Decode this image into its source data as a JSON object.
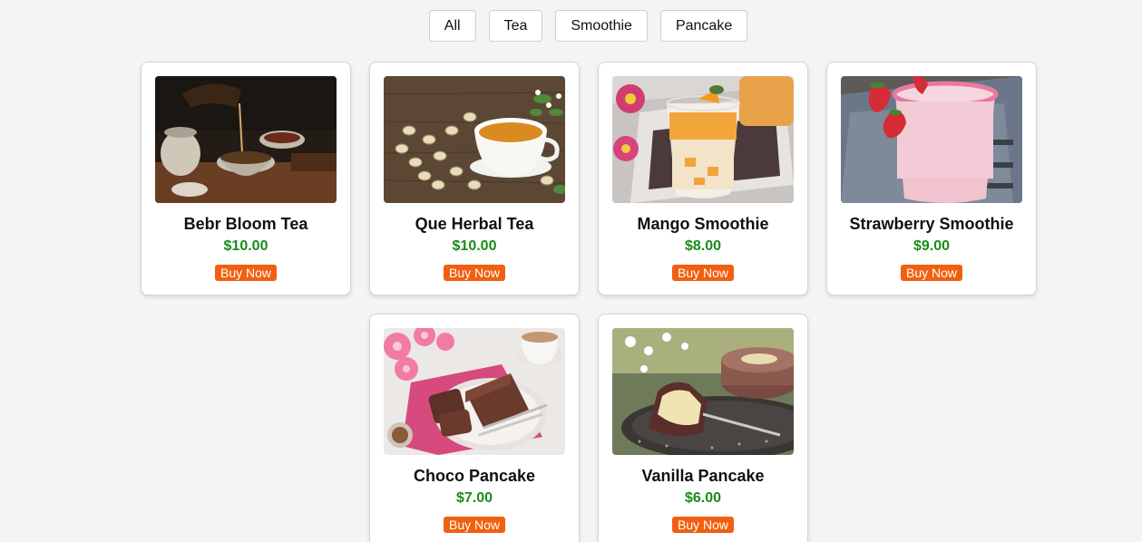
{
  "filters": [
    "All",
    "Tea",
    "Smoothie",
    "Pancake"
  ],
  "products": [
    {
      "name": "Bebr Bloom Tea",
      "price": "$10.00",
      "button": "Buy Now",
      "image": "tea-pouring-image"
    },
    {
      "name": "Que Herbal Tea",
      "price": "$10.00",
      "button": "Buy Now",
      "image": "herbal-tea-cup-image"
    },
    {
      "name": "Mango Smoothie",
      "price": "$8.00",
      "button": "Buy Now",
      "image": "mango-smoothie-image"
    },
    {
      "name": "Strawberry Smoothie",
      "price": "$9.00",
      "button": "Buy Now",
      "image": "strawberry-smoothie-image"
    },
    {
      "name": "Choco Pancake",
      "price": "$7.00",
      "button": "Buy Now",
      "image": "choco-cake-image"
    },
    {
      "name": "Vanilla Pancake",
      "price": "$6.00",
      "button": "Buy Now",
      "image": "vanilla-cheesecake-image"
    }
  ],
  "colors": {
    "buy_button": "#f06010",
    "price": "#1c8a1c",
    "background": "#f4f4f4"
  }
}
